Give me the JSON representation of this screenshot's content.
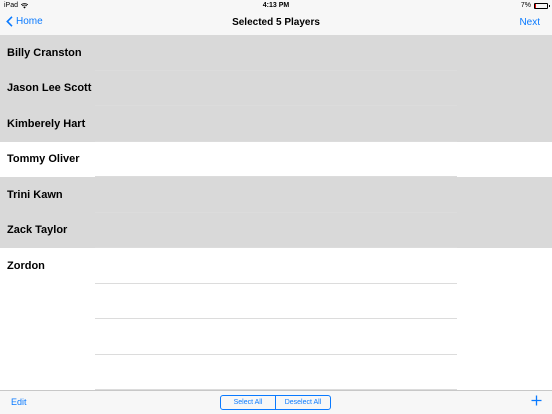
{
  "status_bar": {
    "device": "iPad",
    "time": "4:13 PM",
    "battery": "7%",
    "icons": [
      "wifi-icon",
      "battery-icon"
    ]
  },
  "nav": {
    "back_label": "Home",
    "title": "Selected 5 Players",
    "next_label": "Next"
  },
  "players": [
    {
      "name": "Billy Cranston",
      "selected": true
    },
    {
      "name": "Jason Lee Scott",
      "selected": true
    },
    {
      "name": "Kimberely Hart",
      "selected": true
    },
    {
      "name": "Tommy Oliver",
      "selected": false
    },
    {
      "name": "Trini Kawn",
      "selected": true
    },
    {
      "name": "Zack Taylor",
      "selected": true
    },
    {
      "name": "Zordon",
      "selected": false
    }
  ],
  "toolbar": {
    "edit_label": "Edit",
    "select_all_label": "Select All",
    "deselect_all_label": "Deselect All",
    "add_icon": "plus-icon"
  },
  "colors": {
    "accent": "#0a7aff",
    "selected_row": "#d9d9d9",
    "bar_background": "#f7f7f7"
  }
}
